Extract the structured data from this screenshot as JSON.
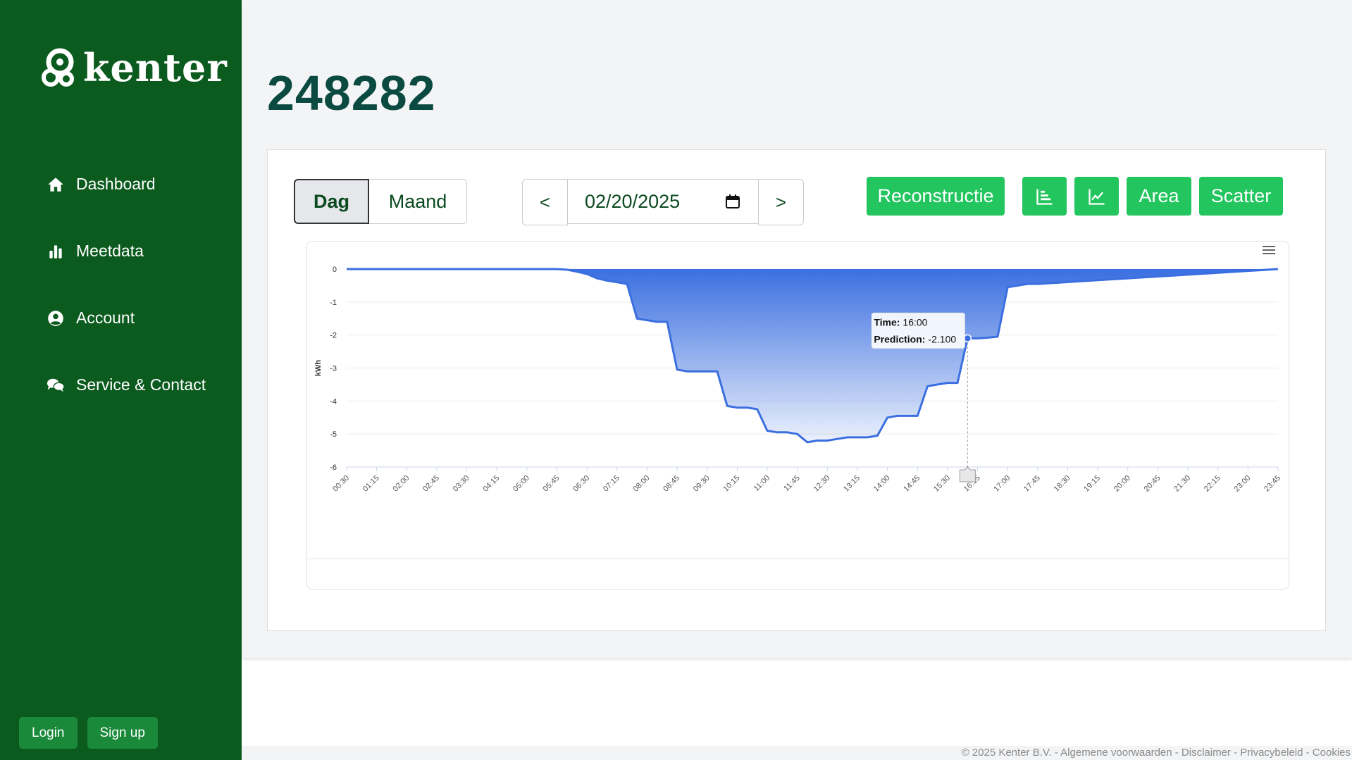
{
  "brand": {
    "name": "kenter"
  },
  "nav": {
    "items": [
      {
        "label": "Dashboard",
        "icon": "home-icon"
      },
      {
        "label": "Meetdata",
        "icon": "bar-chart-icon"
      },
      {
        "label": "Account",
        "icon": "user-circle-icon"
      },
      {
        "label": "Service & Contact",
        "icon": "chat-icon"
      }
    ]
  },
  "auth": {
    "login": "Login",
    "signup": "Sign up"
  },
  "page": {
    "title": "248282"
  },
  "toolbar": {
    "period": {
      "day": "Dag",
      "month": "Maand",
      "selected": "Dag"
    },
    "date": {
      "prev": "<",
      "value": "02/20/2025",
      "next": ">"
    },
    "buttons": {
      "reconstructie": "Reconstructie",
      "area": "Area",
      "scatter": "Scatter"
    }
  },
  "colors": {
    "sidebar": "#0b5a1e",
    "accent": "#22c55e",
    "series": "#3b6fe0",
    "title": "#0b4a40"
  },
  "chart_data": {
    "type": "area",
    "ylabel": "kWh",
    "ylim": [
      -6,
      0
    ],
    "yticks": [
      0,
      -1,
      -2,
      -3,
      -4,
      -5,
      -6
    ],
    "xticks": [
      "00:30",
      "01:15",
      "02:00",
      "02:45",
      "03:30",
      "04:15",
      "05:00",
      "05:45",
      "06:30",
      "07:15",
      "08:00",
      "08:45",
      "09:30",
      "10:15",
      "11:00",
      "11:45",
      "12:30",
      "13:15",
      "14:00",
      "14:45",
      "15:30",
      "16:15",
      "17:00",
      "17:45",
      "18:30",
      "19:15",
      "20:00",
      "20:45",
      "21:30",
      "22:15",
      "23:00",
      "23:45"
    ],
    "series": [
      {
        "x": [
          "00:30",
          "05:45",
          "06:00",
          "06:15",
          "06:30",
          "06:45",
          "07:00",
          "07:15",
          "07:30",
          "07:45",
          "08:00",
          "08:15",
          "08:30",
          "08:45",
          "09:00",
          "09:15",
          "09:30",
          "09:45",
          "10:00",
          "10:15",
          "10:30",
          "10:45",
          "11:00",
          "11:15",
          "11:30",
          "11:45",
          "12:00",
          "12:15",
          "12:30",
          "12:45",
          "13:00",
          "13:15",
          "13:30",
          "13:45",
          "14:00",
          "14:15",
          "14:30",
          "14:45",
          "15:00",
          "15:15",
          "15:30",
          "15:45",
          "16:00",
          "16:15",
          "16:30",
          "16:45",
          "17:00",
          "17:15",
          "17:30",
          "17:45",
          "23:45"
        ],
        "values": [
          0,
          0,
          -0.02,
          -0.08,
          -0.15,
          -0.28,
          -0.35,
          -0.4,
          -0.45,
          -1.5,
          -1.55,
          -1.6,
          -1.6,
          -3.05,
          -3.1,
          -3.1,
          -3.1,
          -3.1,
          -4.15,
          -4.2,
          -4.2,
          -4.25,
          -4.9,
          -4.95,
          -4.95,
          -5.0,
          -5.25,
          -5.2,
          -5.2,
          -5.15,
          -5.1,
          -5.1,
          -5.1,
          -5.05,
          -4.5,
          -4.45,
          -4.45,
          -4.45,
          -3.55,
          -3.5,
          -3.45,
          -3.45,
          -2.1,
          -2.1,
          -2.08,
          -2.05,
          -0.55,
          -0.5,
          -0.45,
          -0.45,
          0
        ]
      }
    ],
    "tooltip": {
      "time_label": "Time:",
      "time_value": "16:00",
      "pred_label": "Prediction:",
      "pred_value": "-2.100"
    }
  },
  "footer": {
    "text": "© 2025 Kenter B.V. - Algemene voorwaarden - Disclaimer - Privacybeleid - Cookies"
  }
}
